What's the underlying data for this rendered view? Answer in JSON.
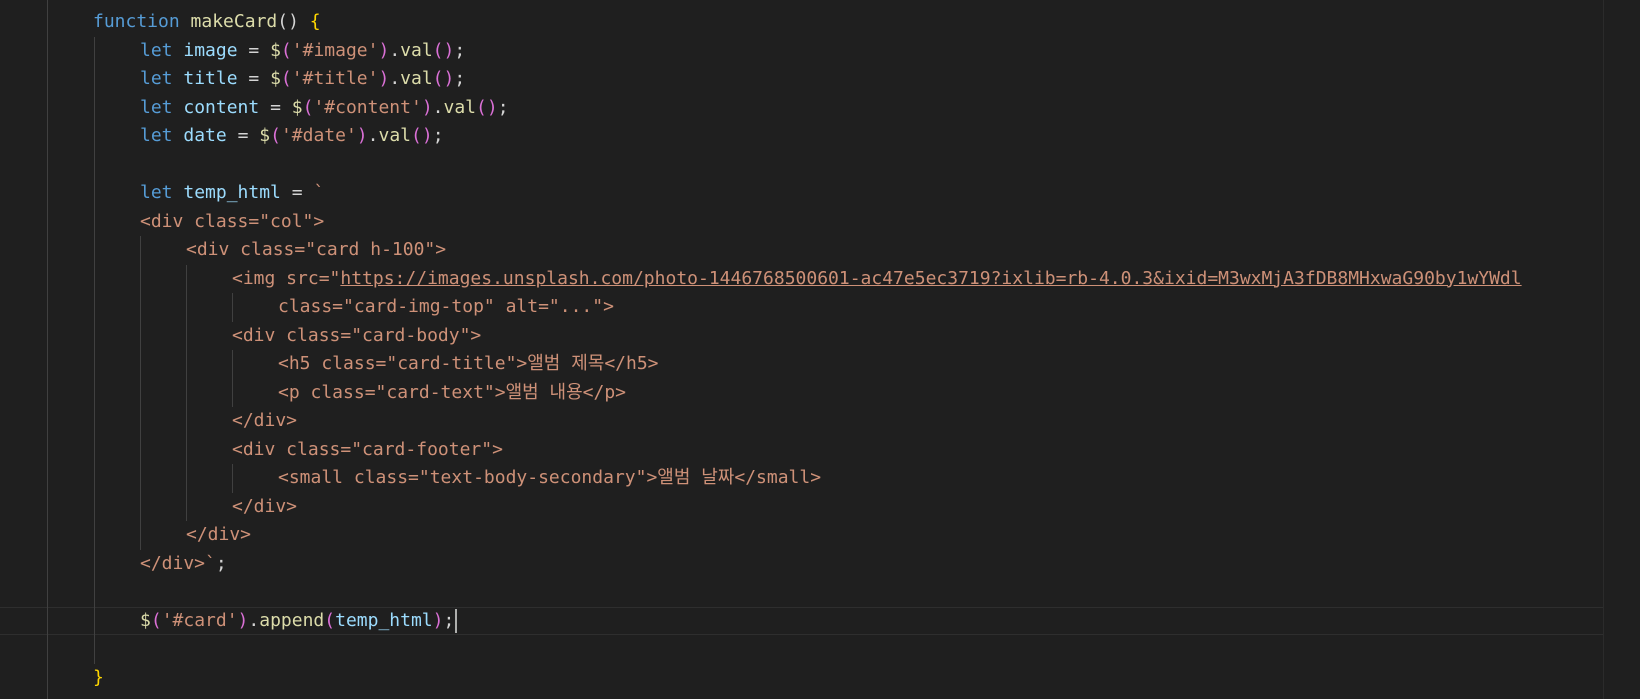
{
  "editor": {
    "colors": {
      "background": "#1f1f1f",
      "keyword": "#569cd6",
      "function": "#dcdcaa",
      "variable": "#9cdcfe",
      "string": "#ce9178",
      "bracket_gold": "#ffd700",
      "bracket_orchid": "#da70d6"
    },
    "lines": {
      "l1_kw": "function",
      "l1_name": "makeCard",
      "l1_parens": "()",
      "l1_brace": "{",
      "l2_kw": "let",
      "l2_var": "image",
      "l2_eq": "=",
      "l2_dollar": "$",
      "l2_open": "(",
      "l2_str": "'#image'",
      "l2_close": ")",
      "l2_method": "val",
      "l2_call": "()",
      "l2_semi": ";",
      "l3_kw": "let",
      "l3_var": "title",
      "l3_eq": "=",
      "l3_dollar": "$",
      "l3_open": "(",
      "l3_str": "'#title'",
      "l3_close": ")",
      "l3_method": "val",
      "l3_call": "()",
      "l3_semi": ";",
      "l4_kw": "let",
      "l4_var": "content",
      "l4_eq": "=",
      "l4_dollar": "$",
      "l4_open": "(",
      "l4_str": "'#content'",
      "l4_close": ")",
      "l4_method": "val",
      "l4_call": "()",
      "l4_semi": ";",
      "l5_kw": "let",
      "l5_var": "date",
      "l5_eq": "=",
      "l5_dollar": "$",
      "l5_open": "(",
      "l5_str": "'#date'",
      "l5_close": ")",
      "l5_method": "val",
      "l5_call": "()",
      "l5_semi": ";",
      "l7_kw": "let",
      "l7_var": "temp_html",
      "l7_eq": "=",
      "l7_tick": "`",
      "l8": "<div class=\"col\">",
      "l9": "<div class=\"card h-100\">",
      "l10_pre": "<img src=\"",
      "l10_url": "https://images.unsplash.com/photo-1446768500601-ac47e5ec3719?ixlib=rb-4.0.3&ixid=M3wxMjA3fDB8MHxwaG90by1wYWdl",
      "l11": "class=\"card-img-top\" alt=\"...\">",
      "l12": "<div class=\"card-body\">",
      "l13": "<h5 class=\"card-title\">앨범 제목</h5>",
      "l14": "<p class=\"card-text\">앨범 내용</p>",
      "l15": "</div>",
      "l16": "<div class=\"card-footer\">",
      "l17": "<small class=\"text-body-secondary\">앨범 날짜</small>",
      "l18": "</div>",
      "l19": "</div>",
      "l20": "</div>`",
      "l20_semi": ";",
      "l22_dollar": "$",
      "l22_open": "(",
      "l22_str": "'#card'",
      "l22_close": ")",
      "l22_method": "append",
      "l22_open2": "(",
      "l22_arg": "temp_html",
      "l22_close2": ")",
      "l22_semi": ";",
      "l24_brace": "}"
    }
  }
}
